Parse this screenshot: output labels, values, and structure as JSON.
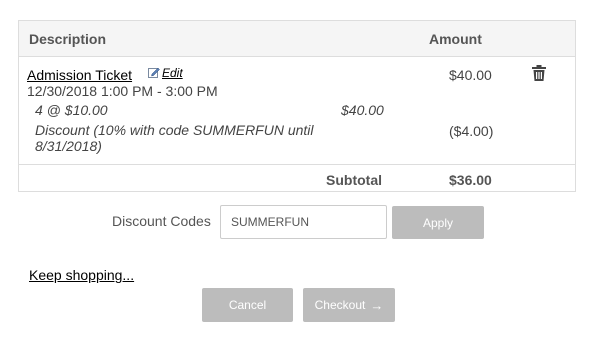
{
  "cart": {
    "headers": {
      "description": "Description",
      "amount": "Amount"
    },
    "item": {
      "name": "Admission Ticket",
      "edit_label": "Edit",
      "date": "12/30/2018 1:00 PM - 3:00 PM",
      "amount": "$40.00",
      "qty_line": "4 @ $10.00",
      "qty_total": "$40.00",
      "discount_text": "Discount (10% with code SUMMERFUN until 8/31/2018)",
      "discount_amount": "($4.00)"
    },
    "subtotal": {
      "label": "Subtotal",
      "value": "$36.00"
    }
  },
  "discount": {
    "label": "Discount Codes",
    "input_value": "SUMMERFUN",
    "apply_label": "Apply"
  },
  "actions": {
    "keep_shopping": "Keep shopping...",
    "cancel": "Cancel",
    "checkout": "Checkout",
    "checkout_arrow": "→"
  },
  "colors": {
    "button_bg": "#bcbcbc",
    "header_bg": "#f5f5f5",
    "border": "#dddddd"
  },
  "icons": {
    "edit": "edit-pencil-icon",
    "delete": "trash-icon"
  }
}
